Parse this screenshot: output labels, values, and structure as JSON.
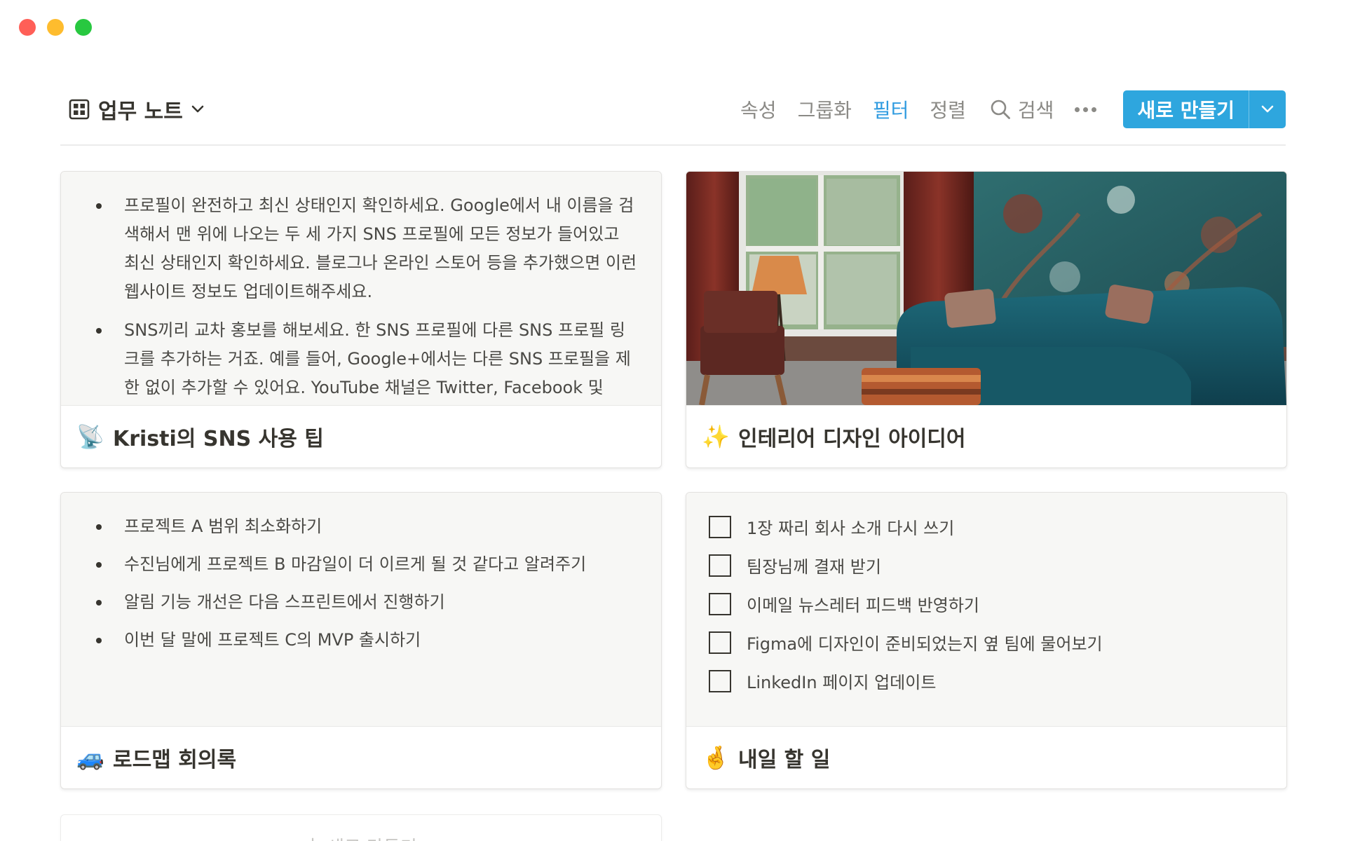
{
  "toolbar": {
    "view_title": "업무 노트",
    "properties": "속성",
    "group": "그룹화",
    "filter": "필터",
    "sort": "정렬",
    "search": "검색",
    "new_button": "새로 만들기",
    "accent_color": "#2ea6de"
  },
  "cards": [
    {
      "title": "Kristi의 SNS 사용 팁",
      "icon": "satellite-dish-icon",
      "emoji": "📡",
      "bullets": [
        "프로필이 완전하고 최신 상태인지 확인하세요. Google에서 내 이름을 검색해서 맨 위에 나오는 두 세 가지 SNS 프로필에 모든 정보가 들어있고 최신 상태인지 확인하세요. 블로그나 온라인 스토어 등을 추가했으면 이런 웹사이트 정보도 업데이트해주세요.",
        "SNS끼리 교차 홍보를 해보세요. 한 SNS 프로필에 다른 SNS 프로필 링크를 추가하는 거죠. 예를 들어, Google+에서는 다른 SNS 프로필을 제한 없이 추가할 수 있어요. YouTube 채널은 Twitter, Facebook 및"
      ]
    },
    {
      "title": "인테리어 디자인 아이디어",
      "icon": "sparkles-icon",
      "emoji": "✨"
    },
    {
      "title": "로드맵 회의록",
      "icon": "car-icon",
      "emoji": "🚙",
      "bullets": [
        "프로젝트 A 범위 최소화하기",
        "수진님에게 프로젝트 B 마감일이 더 이르게 될 것 같다고 알려주기",
        "알림 기능 개선은 다음 스프린트에서 진행하기",
        "이번 달 말에 프로젝트 C의 MVP 출시하기"
      ]
    },
    {
      "title": "내일 할 일",
      "icon": "crossed-fingers-icon",
      "emoji": "🤞",
      "todos": [
        "1장 짜리 회사 소개 다시 쓰기",
        "팀장님께 결재 받기",
        "이메일 뉴스레터 피드백 반영하기",
        "Figma에 디자인이 준비되었는지 옆 팀에 물어보기",
        "LinkedIn 페이지 업데이트"
      ]
    }
  ],
  "add_card": {
    "label": "새로 만들기",
    "plus": "+"
  }
}
